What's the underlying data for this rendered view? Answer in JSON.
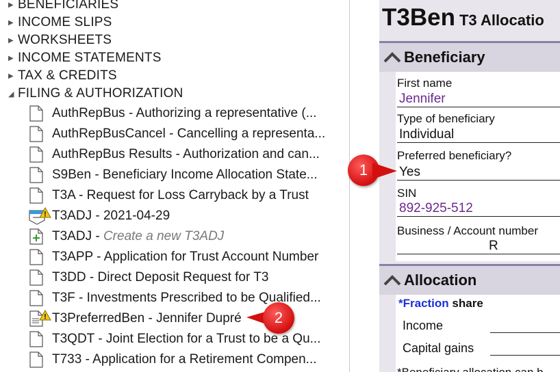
{
  "tree": {
    "categories": [
      {
        "label": "BENEFICIARIES",
        "expanded": false
      },
      {
        "label": "INCOME SLIPS",
        "expanded": false
      },
      {
        "label": "WORKSHEETS",
        "expanded": false
      },
      {
        "label": "INCOME STATEMENTS",
        "expanded": false
      },
      {
        "label": "TAX & CREDITS",
        "expanded": false
      },
      {
        "label": "FILING & AUTHORIZATION",
        "expanded": true
      }
    ],
    "items": [
      {
        "label": "AuthRepBus - Authorizing a representative (...",
        "icon": "document-icon"
      },
      {
        "label": "AuthRepBusCancel - Cancelling a representa...",
        "icon": "document-icon"
      },
      {
        "label": "AuthRepBus Results - Authorization and can...",
        "icon": "document-icon"
      },
      {
        "label": "S9Ben - Beneficiary Income Allocation State...",
        "icon": "document-icon"
      },
      {
        "label": "T3A - Request for Loss Carryback by a Trust",
        "icon": "document-icon"
      },
      {
        "label": "T3ADJ - 2021-04-29",
        "icon": "adjustment-warning-icon"
      },
      {
        "label_prefix": "T3ADJ - ",
        "label_italic": "Create a new T3ADJ",
        "icon": "add-document-icon"
      },
      {
        "label": "T3APP - Application for Trust Account Number",
        "icon": "document-icon"
      },
      {
        "label": "T3DD - Direct Deposit Request for T3",
        "icon": "document-icon"
      },
      {
        "label": "T3F - Investments Prescribed to be Qualified...",
        "icon": "document-icon"
      },
      {
        "label": "T3PreferredBen - Jennifer Dupré",
        "icon": "document-warning-icon"
      },
      {
        "label": "T3QDT - Joint Election for a Trust to be a Qu...",
        "icon": "document-icon"
      },
      {
        "label": "T733 - Application for a Retirement Compen...",
        "icon": "document-icon"
      }
    ]
  },
  "form": {
    "title": "T3Ben",
    "subtitle": "T3 Allocatio",
    "beneficiary_section": "Beneficiary",
    "fields": {
      "first_name_label": "First name",
      "first_name_value": "Jennifer",
      "type_label": "Type of beneficiary",
      "type_value": "Individual",
      "preferred_label": "Preferred beneficiary?",
      "preferred_value": "Yes",
      "sin_label": "SIN",
      "sin_value": "892-925-512",
      "bn_label": "Business / Account number",
      "bn_value": "R"
    },
    "allocation_section": "Allocation",
    "fraction_prefix": "*Fraction",
    "fraction_suffix": " share",
    "income_label": "Income",
    "capital_gains_label": "Capital gains",
    "footnote": "*Beneficiary allocation can b"
  },
  "callouts": {
    "badge1": "1",
    "badge2": "2"
  },
  "colors": {
    "callout_red": "#d30f0f",
    "value_purple": "#6a2a8c",
    "link_blue": "#1a2fd8",
    "section_border": "#8a7fa8",
    "warning_yellow": "#f5c518"
  }
}
